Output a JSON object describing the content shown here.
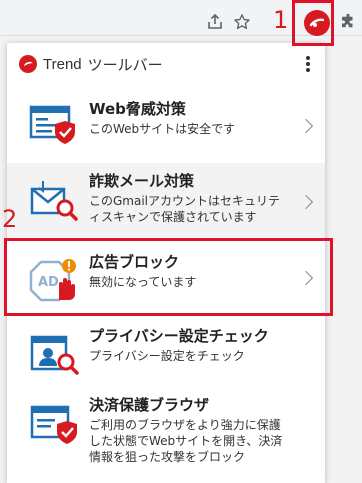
{
  "toolbar": {
    "share_icon": "share-icon",
    "star_icon": "bookmark-star-icon",
    "extension_icon": "trend-micro-extension-icon",
    "puzzle_icon": "extensions-puzzle-icon"
  },
  "annotations": {
    "step1": "1",
    "step2": "2",
    "highlight_color": "#e0112b"
  },
  "popup": {
    "brand": "Trend",
    "title": "ツールバー",
    "menu_icon": "more-vertical-icon",
    "brand_color": "#d71920"
  },
  "items": [
    {
      "title": "Web脅威対策",
      "desc": "このWebサイトは安全です",
      "icon": "web-threat-shield-icon"
    },
    {
      "title": "詐欺メール対策",
      "desc": "このGmailアカウントはセキュリティスキャンで保護されています",
      "icon": "email-scam-search-icon"
    },
    {
      "title": "広告ブロック",
      "desc": "無効になっています",
      "icon": "ad-block-hand-icon"
    },
    {
      "title": "プライバシー設定チェック",
      "desc": "プライバシー設定をチェック",
      "icon": "privacy-check-icon"
    },
    {
      "title": "決済保護ブラウザ",
      "desc": "ご利用のブラウザをより強力に保護した状態でWebサイトを開き、決済情報を狙った攻撃をブロック",
      "icon": "payment-guard-browser-icon"
    }
  ]
}
